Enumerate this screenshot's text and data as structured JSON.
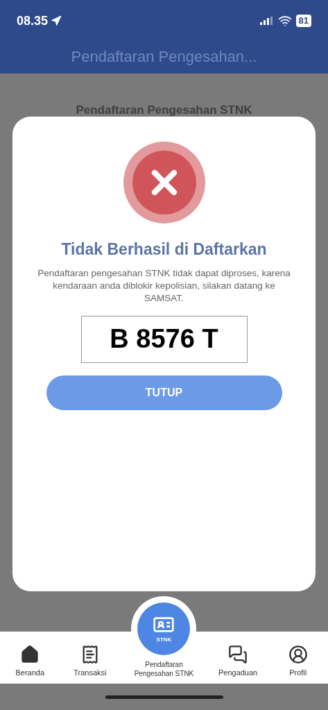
{
  "status_bar": {
    "time": "08.35",
    "battery": "81"
  },
  "header": {
    "title": "Pendaftaran Pengesahan..."
  },
  "background_heading": "Pendaftaran Pengesahan STNK",
  "dialog": {
    "title": "Tidak Berhasil di Daftarkan",
    "message": "Pendaftaran pengesahan STNK tidak dapat diproses, karena kendaraan anda diblokir kepolisian, silakan datang ke SAMSAT.",
    "plate": "B 8576 T",
    "button": "TUTUP"
  },
  "nav": [
    {
      "kind": "home",
      "label": "Beranda"
    },
    {
      "kind": "receipt",
      "label": "Transaksi"
    },
    {
      "kind": "center",
      "label": "Pendaftaran Pengesahan STNK",
      "badge": "STNK"
    },
    {
      "kind": "chat",
      "label": "Pengaduan"
    },
    {
      "kind": "profile",
      "label": "Profil"
    }
  ]
}
